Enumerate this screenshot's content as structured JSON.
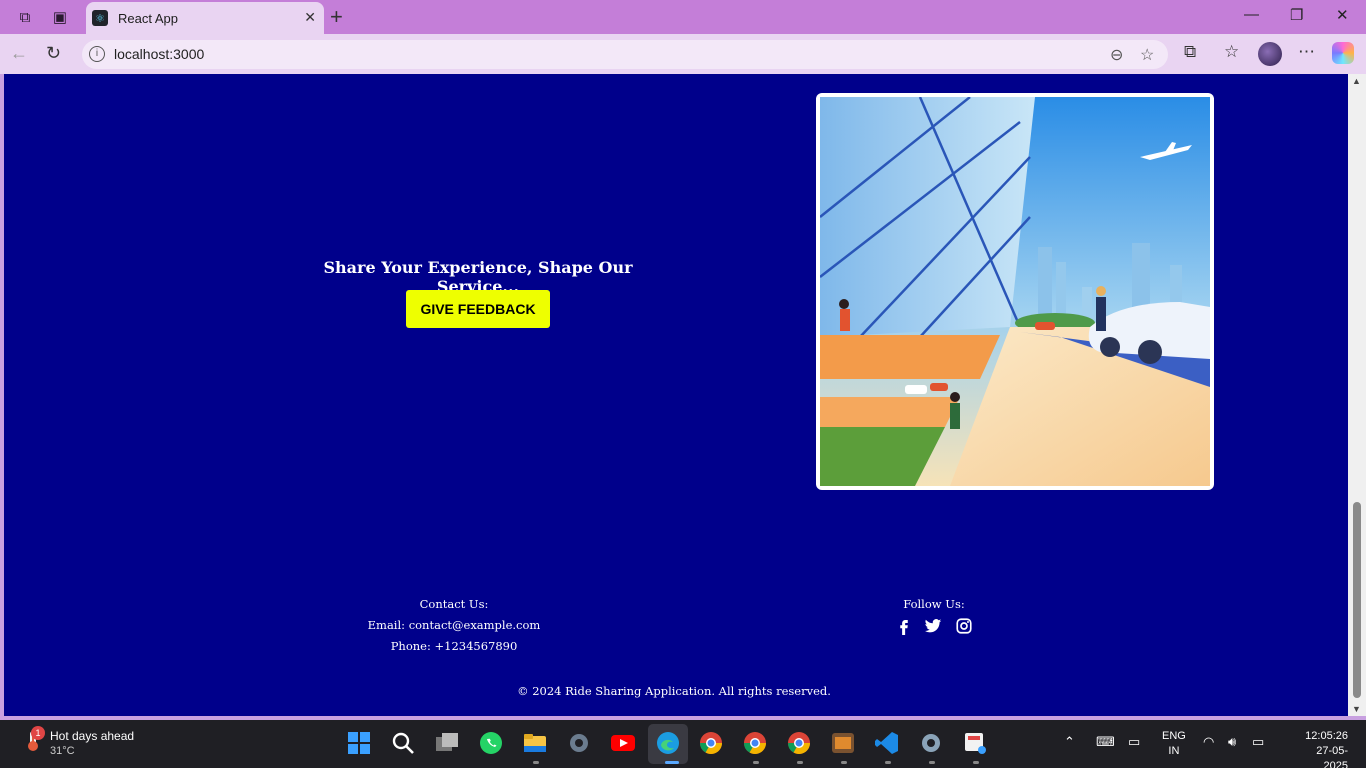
{
  "browser": {
    "tab_title": "React App",
    "url": "localhost:3000"
  },
  "page": {
    "hero_heading": "Share Your Experience, Shape Our Service...",
    "feedback_button": "GIVE FEEDBACK",
    "contact_heading": "Contact Us:",
    "contact_email": "Email: contact@example.com",
    "contact_phone": "Phone: +1234567890",
    "follow_heading": "Follow Us:",
    "social_icons": [
      "facebook-icon",
      "twitter-icon",
      "instagram-icon"
    ],
    "copyright": "© 2024 Ride Sharing Application. All rights reserved.",
    "colors": {
      "background": "#00008b",
      "button": "#eeff00"
    }
  },
  "taskbar": {
    "weather_title": "Hot days ahead",
    "weather_temp": "31°C",
    "weather_badge": "1",
    "lang_line1": "ENG",
    "lang_line2": "IN",
    "time": "12:05:26",
    "date": "27-05-2025"
  }
}
